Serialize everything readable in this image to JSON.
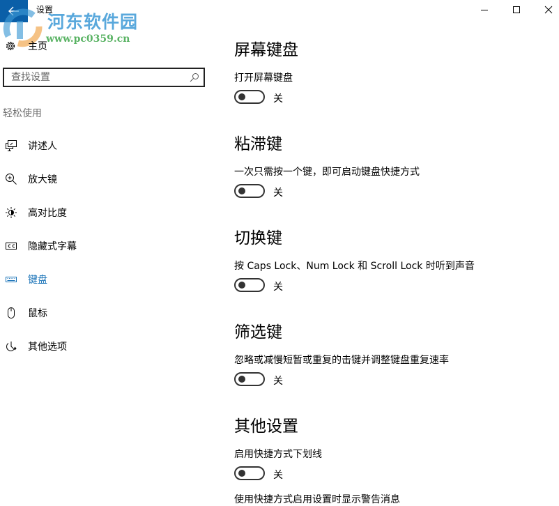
{
  "window": {
    "title": "设置",
    "back_icon": "back-arrow-icon",
    "controls": {
      "minimize_icon": "minimize-icon",
      "maximize_icon": "maximize-icon",
      "close_icon": "close-icon"
    }
  },
  "watermark": {
    "name": "河东软件园",
    "url": "www.pc0359.cn"
  },
  "sidebar": {
    "home": {
      "icon": "gear-icon",
      "label": "主页"
    },
    "search": {
      "placeholder": "查找设置",
      "value": "",
      "icon": "search-icon"
    },
    "group_label": "轻松使用",
    "items": [
      {
        "icon": "narrator-icon",
        "label": "讲述人",
        "active": false
      },
      {
        "icon": "magnifier-icon",
        "label": "放大镜",
        "active": false
      },
      {
        "icon": "high-contrast-icon",
        "label": "高对比度",
        "active": false
      },
      {
        "icon": "closed-captions-icon",
        "label": "隐藏式字幕",
        "active": false
      },
      {
        "icon": "keyboard-icon",
        "label": "键盘",
        "active": true
      },
      {
        "icon": "mouse-icon",
        "label": "鼠标",
        "active": false
      },
      {
        "icon": "other-options-icon",
        "label": "其他选项",
        "active": false
      }
    ],
    "accent_color": "#1a73b8"
  },
  "main": {
    "sections": [
      {
        "title": "屏幕键盘",
        "description": "打开屏幕键盘",
        "toggle_on": false,
        "toggle_label": "关"
      },
      {
        "title": "粘滞键",
        "description": "一次只需按一个键，即可启动键盘快捷方式",
        "toggle_on": false,
        "toggle_label": "关"
      },
      {
        "title": "切换键",
        "description": "按 Caps Lock、Num Lock 和 Scroll Lock 时听到声音",
        "toggle_on": false,
        "toggle_label": "关"
      },
      {
        "title": "筛选键",
        "description": "忽略或减慢短暂或重复的击键并调整键盘重复速率",
        "toggle_on": false,
        "toggle_label": "关"
      },
      {
        "title": "其他设置",
        "description": "启用快捷方式下划线",
        "toggle_on": false,
        "toggle_label": "关"
      }
    ],
    "cut_off_text": "使用快捷方式启用设置时显示警告消息"
  }
}
